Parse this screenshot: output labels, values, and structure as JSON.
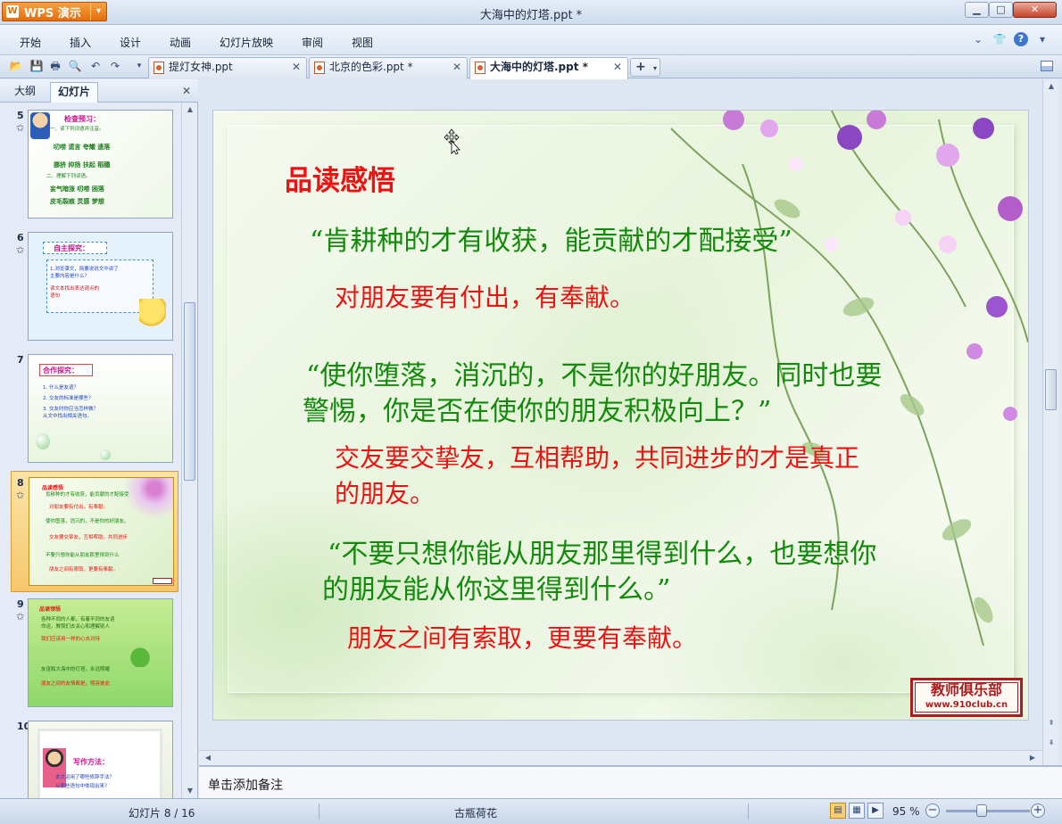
{
  "app": {
    "menu_button": "WPS 演示",
    "window_title": "大海中的灯塔.ppt *"
  },
  "menu": {
    "items": [
      "开始",
      "插入",
      "设计",
      "动画",
      "幻灯片放映",
      "审阅",
      "视图"
    ]
  },
  "tabs": [
    {
      "label": "提灯女神.ppt"
    },
    {
      "label": "北京的色彩.ppt *"
    },
    {
      "label": "大海中的灯塔.ppt *"
    }
  ],
  "left_panel": {
    "tabs": [
      "大纲",
      "幻灯片"
    ],
    "thumbnails": [
      {
        "number": "5",
        "title": "检查预习：",
        "lines": [
          "一、读下列词语并注音。",
          "叨唠  谎言  夸耀  遗落",
          "挪挤  抑扬  扶起  稻穗",
          "二、理解下列词语。",
          "妄气暗涨  叨唠  困落",
          "皮毛裂痕  灵感  梦想"
        ]
      },
      {
        "number": "6",
        "title": "自主探究：",
        "lines": [
          "1.浏览课文，简要说说文中讲了",
          "主要内容是什么？",
          "读文本找出表达观点的",
          "语句"
        ]
      },
      {
        "number": "7",
        "title": "合作探究：",
        "lines": [
          "1. 什么是友谊？",
          "2. 交友的标准是哪些？",
          "3. 交友时你应当怎样做？",
          "从文中找出相关语句。"
        ]
      },
      {
        "number": "8",
        "title": "品读感悟",
        "lines": [
          "肯耕种的才有收获，能贡献的才配接受",
          "对朋友要有付出，有奉献。",
          "使你堕落，消沉的，不是你的好朋友。",
          "交友要交挚友，互相帮助，共同进步",
          "不要只想你能从朋友那里得到什么",
          "朋友之间有索取，更要有奉献。"
        ]
      },
      {
        "number": "9",
        "title": "品读领悟",
        "lines": [
          "各种不同的人都，有着不同的友谊",
          "命运，教我们去关心和理解别人",
          "我们应该用一样的心去对待",
          "友谊和大海中的灯塔，永远照耀",
          "朋友之间的友情都是，照亮彼此"
        ]
      },
      {
        "number": "10",
        "title": "写作方法：",
        "lines": [
          "本文运用了哪些修辞手法？",
          "从那些语句中体现出来？"
        ]
      }
    ]
  },
  "slide": {
    "heading": "品读感悟",
    "quote1": "“肯耕种的才有收获，能贡献的才配接受”",
    "comment1": "对朋友要有付出，有奉献。",
    "quote2_line1": "“使你堕落，消沉的，不是你的好朋友。同时也要",
    "quote2_line2": "警惕，你是否在使你的朋友积极向上？”",
    "comment2_line1": "交友要交挚友，互相帮助，共同进步的才是真正",
    "comment2_line2": "的朋友。",
    "quote3_line1": "“不要只想你能从朋友那里得到什么，也要想你",
    "quote3_line2": "的朋友能从你这里得到什么。”",
    "comment3": "朋友之间有索取，更要有奉献。",
    "stamp_title": "教师俱乐部",
    "stamp_url": "www.910club.cn"
  },
  "notes": {
    "placeholder": "单击添加备注"
  },
  "status": {
    "slide_counter": "幻灯片 8 / 16",
    "theme": "古瓶荷花",
    "zoom": "95 %"
  }
}
